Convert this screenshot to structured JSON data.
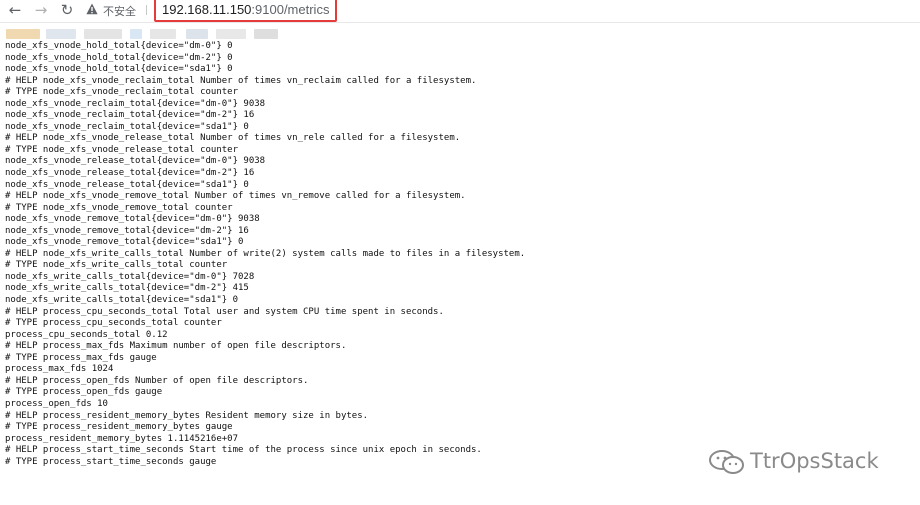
{
  "browser": {
    "security_label": "不安全",
    "url_host": "192.168.11.150",
    "url_path": ":9100/metrics"
  },
  "metrics_lines": [
    "node_xfs_vnode_hold_total{device=\"dm-0\"} 0",
    "node_xfs_vnode_hold_total{device=\"dm-2\"} 0",
    "node_xfs_vnode_hold_total{device=\"sda1\"} 0",
    "# HELP node_xfs_vnode_reclaim_total Number of times vn_reclaim called for a filesystem.",
    "# TYPE node_xfs_vnode_reclaim_total counter",
    "node_xfs_vnode_reclaim_total{device=\"dm-0\"} 9038",
    "node_xfs_vnode_reclaim_total{device=\"dm-2\"} 16",
    "node_xfs_vnode_reclaim_total{device=\"sda1\"} 0",
    "# HELP node_xfs_vnode_release_total Number of times vn_rele called for a filesystem.",
    "# TYPE node_xfs_vnode_release_total counter",
    "node_xfs_vnode_release_total{device=\"dm-0\"} 9038",
    "node_xfs_vnode_release_total{device=\"dm-2\"} 16",
    "node_xfs_vnode_release_total{device=\"sda1\"} 0",
    "# HELP node_xfs_vnode_remove_total Number of times vn_remove called for a filesystem.",
    "# TYPE node_xfs_vnode_remove_total counter",
    "node_xfs_vnode_remove_total{device=\"dm-0\"} 9038",
    "node_xfs_vnode_remove_total{device=\"dm-2\"} 16",
    "node_xfs_vnode_remove_total{device=\"sda1\"} 0",
    "# HELP node_xfs_write_calls_total Number of write(2) system calls made to files in a filesystem.",
    "# TYPE node_xfs_write_calls_total counter",
    "node_xfs_write_calls_total{device=\"dm-0\"} 7028",
    "node_xfs_write_calls_total{device=\"dm-2\"} 415",
    "node_xfs_write_calls_total{device=\"sda1\"} 0",
    "# HELP process_cpu_seconds_total Total user and system CPU time spent in seconds.",
    "# TYPE process_cpu_seconds_total counter",
    "process_cpu_seconds_total 0.12",
    "# HELP process_max_fds Maximum number of open file descriptors.",
    "# TYPE process_max_fds gauge",
    "process_max_fds 1024",
    "# HELP process_open_fds Number of open file descriptors.",
    "# TYPE process_open_fds gauge",
    "process_open_fds 10",
    "# HELP process_resident_memory_bytes Resident memory size in bytes.",
    "# TYPE process_resident_memory_bytes gauge",
    "process_resident_memory_bytes 1.1145216e+07",
    "# HELP process_start_time_seconds Start time of the process since unix epoch in seconds.",
    "# TYPE process_start_time_seconds gauge"
  ],
  "watermark": {
    "text": "TtrOpsStack"
  }
}
